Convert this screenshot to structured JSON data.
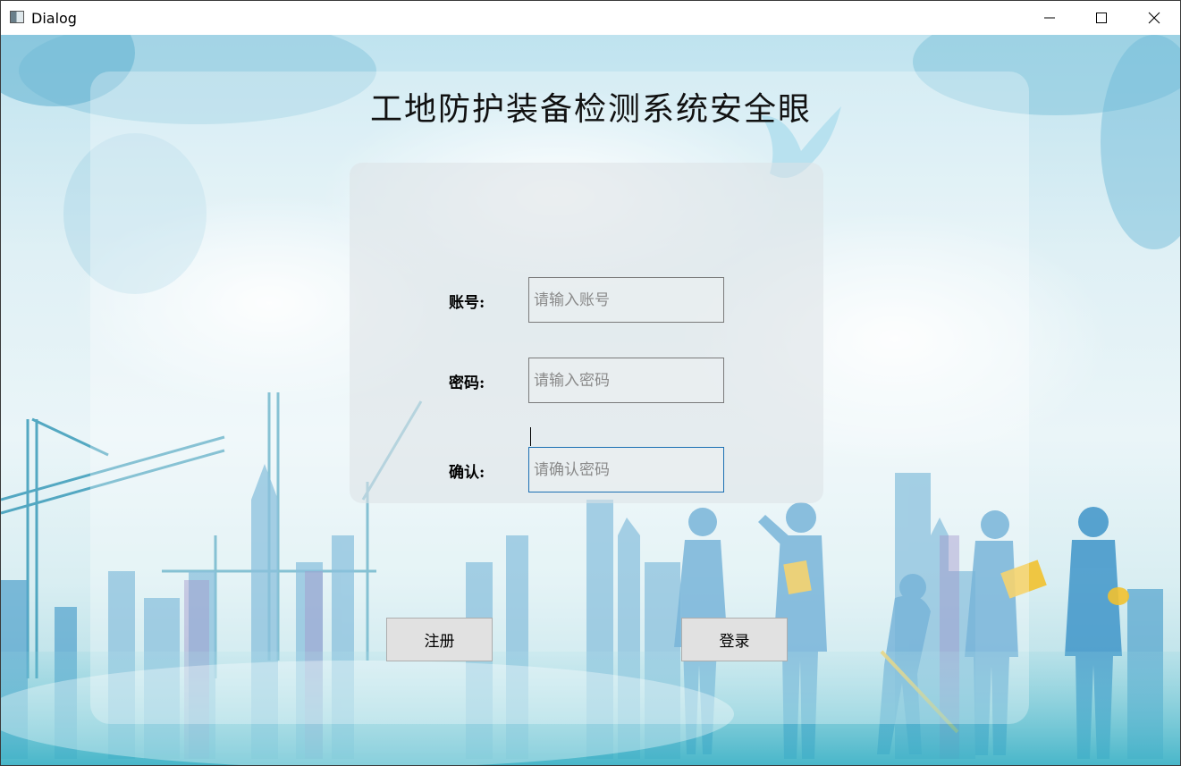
{
  "window": {
    "title": "Dialog",
    "controls": {
      "minimize_icon": "minimize-icon",
      "maximize_icon": "maximize-icon",
      "close_icon": "close-icon"
    }
  },
  "main": {
    "title": "工地防护装备检测系统安全眼",
    "form": {
      "account": {
        "label": "账号:",
        "placeholder": "请输入账号",
        "value": ""
      },
      "password": {
        "label": "密码:",
        "placeholder": "请输入密码",
        "value": ""
      },
      "confirm": {
        "label": "确认:",
        "placeholder": "请确认密码",
        "value": "",
        "focused": true
      }
    },
    "buttons": {
      "register": "注册",
      "login": "登录"
    }
  },
  "colors": {
    "focus_border": "#1b6fb3",
    "button_bg": "#e1e1e1",
    "sky": "#bfe3ef",
    "silhouette": "#3f95c9",
    "accent_yellow": "#f2c230"
  }
}
